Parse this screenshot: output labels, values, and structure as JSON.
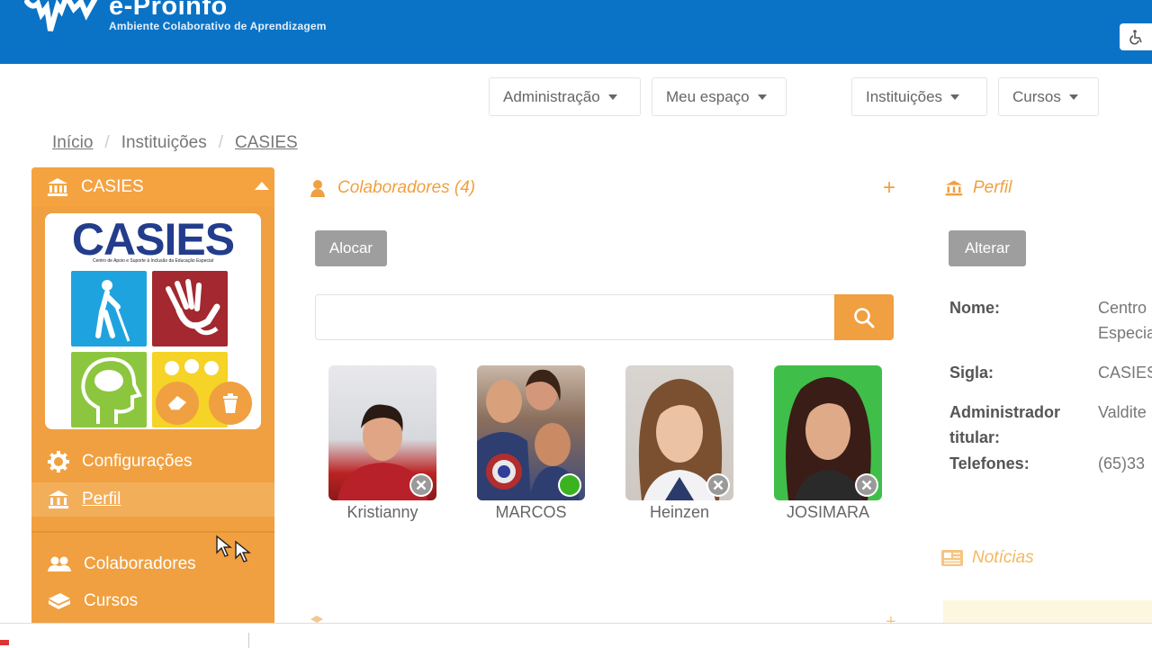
{
  "header": {
    "brand_title": "e-Proinfo",
    "brand_subtitle": "Ambiente Colaborativo de Aprendizagem",
    "accessibility_icon": "wheelchair-icon"
  },
  "nav": {
    "admin": "Administração",
    "my_space": "Meu espaço",
    "institutions": "Instituições",
    "courses": "Cursos"
  },
  "breadcrumb": [
    "Início",
    "Instituições",
    "CASIES"
  ],
  "sidebar": {
    "title": "CASIES",
    "logo_text": "CASIES",
    "logo_subtitle": "Centro de Apoio e Suporte à Inclusão da Educação Especial",
    "items": [
      {
        "label": "Configurações",
        "icon": "gear-icon"
      },
      {
        "label": "Perfil",
        "icon": "bank-icon"
      },
      {
        "label": "Colaboradores",
        "icon": "users-icon"
      },
      {
        "label": "Cursos",
        "icon": "book-icon"
      }
    ]
  },
  "collaborators": {
    "heading": "Colaboradores (4)",
    "allocate_label": "Alocar",
    "search_placeholder": "",
    "people": [
      {
        "name": "Kristianny",
        "status": "remove"
      },
      {
        "name": "MARCOS",
        "status": "online"
      },
      {
        "name": "Heinzen",
        "status": "remove"
      },
      {
        "name": "JOSIMARA",
        "status": "remove"
      }
    ]
  },
  "profile": {
    "heading": "Perfil",
    "edit_label": "Alterar",
    "fields": [
      {
        "label": "Nome:",
        "value": [
          "Centro",
          "Especia"
        ]
      },
      {
        "label": "Sigla:",
        "value": [
          "CASIES"
        ]
      },
      {
        "label": "Administrador titular:",
        "value": [
          "Valdite"
        ]
      },
      {
        "label": "Telefones:",
        "value": [
          "(65)33"
        ]
      }
    ]
  },
  "news": {
    "heading": "Notícias"
  },
  "colors": {
    "primary": "#0a73c6",
    "accent": "#f0a040",
    "button_gray": "#9e9e9e"
  }
}
